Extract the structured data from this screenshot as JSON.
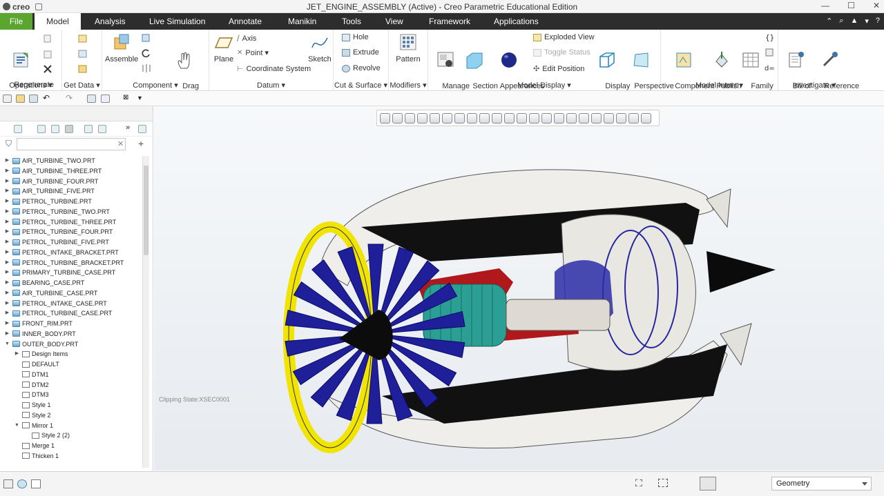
{
  "window": {
    "brand": "creo",
    "title": "JET_ENGINE_ASSEMBLY (Active) - Creo Parametric Educational Edition"
  },
  "tabs": {
    "file": "File",
    "model": "Model",
    "analysis": "Analysis",
    "live": "Live Simulation",
    "annotate": "Annotate",
    "manikin": "Manikin",
    "tools": "Tools",
    "view": "View",
    "framework": "Framework",
    "applications": "Applications"
  },
  "ribbon": {
    "operations": {
      "regenerate": "Regenerate",
      "label": "Operations ▾"
    },
    "getdata": {
      "label": "Get Data ▾"
    },
    "component": {
      "assemble": "Assemble",
      "drag": "Drag\nComponents",
      "label": "Component ▾"
    },
    "datum": {
      "plane": "Plane",
      "axis": "Axis",
      "point": "Point ▾",
      "csys": "Coordinate System",
      "sketch": "Sketch",
      "label": "Datum ▾"
    },
    "cut": {
      "hole": "Hole",
      "extrude": "Extrude",
      "revolve": "Revolve",
      "label": "Cut & Surface ▾"
    },
    "modifiers": {
      "pattern": "Pattern",
      "label": "Modifiers ▾"
    },
    "display": {
      "manage": "Manage\nViews ▾",
      "section": "Section\n▾",
      "appearances": "Appearances\n▾",
      "exploded": "Exploded View",
      "toggle": "Toggle Status",
      "editpos": "Edit Position",
      "dstyle": "Display\nStyle ▾",
      "persp": "Perspective\nView",
      "label": "Model Display ▾"
    },
    "intent": {
      "compif": "Component\nInterface",
      "publish": "Publish\nGeometry",
      "family": "Family\nTable",
      "label": "Model Intent ▾"
    },
    "investigate": {
      "bom": "Bill of\nMaterials",
      "refviewer": "Reference\nViewer",
      "label": "Investigate ▾"
    }
  },
  "tree": {
    "rows": [
      {
        "label": "AIR_TURBINE_TWO.PRT",
        "type": "part",
        "exp": true
      },
      {
        "label": "AIR_TURBINE_THREE.PRT",
        "type": "part",
        "exp": true
      },
      {
        "label": "AIR_TURBINE_FOUR.PRT",
        "type": "part",
        "exp": true
      },
      {
        "label": "AIR_TURBINE_FIVE.PRT",
        "type": "part",
        "exp": true
      },
      {
        "label": "PETROL_TURBINE.PRT",
        "type": "part",
        "exp": true
      },
      {
        "label": "PETROL_TURBINE_TWO.PRT",
        "type": "part",
        "exp": true
      },
      {
        "label": "PETROL_TURBINE_THREE.PRT",
        "type": "part",
        "exp": true
      },
      {
        "label": "PETROL_TURBINE_FOUR.PRT",
        "type": "part",
        "exp": true
      },
      {
        "label": "PETROL_TURBINE_FIVE.PRT",
        "type": "part",
        "exp": true
      },
      {
        "label": "PETROL_INTAKE_BRACKET.PRT",
        "type": "part",
        "exp": true
      },
      {
        "label": "PETROL_TURBINE_BRACKET.PRT",
        "type": "part",
        "exp": true
      },
      {
        "label": "PRIMARY_TURBINE_CASE.PRT",
        "type": "part",
        "exp": true
      },
      {
        "label": "BEARING_CASE.PRT",
        "type": "part",
        "exp": true
      },
      {
        "label": "AIR_TURBINE_CASE.PRT",
        "type": "part",
        "exp": true
      },
      {
        "label": "PETROL_INTAKE_CASE.PRT",
        "type": "part",
        "exp": true
      },
      {
        "label": "PETROL_TURBINE_CASE.PRT",
        "type": "part",
        "exp": true
      },
      {
        "label": "FRONT_RIM.PRT",
        "type": "part",
        "exp": true
      },
      {
        "label": "INNER_BODY.PRT",
        "type": "part",
        "exp": true
      },
      {
        "label": "OUTER_BODY.PRT",
        "type": "part",
        "exp": "open"
      },
      {
        "label": "Design Items",
        "type": "feat",
        "indent": 1,
        "exp": true
      },
      {
        "label": "DEFAULT",
        "type": "feat",
        "indent": 1
      },
      {
        "label": "DTM1",
        "type": "feat",
        "indent": 1
      },
      {
        "label": "DTM2",
        "type": "feat",
        "indent": 1
      },
      {
        "label": "DTM3",
        "type": "feat",
        "indent": 1
      },
      {
        "label": "Style 1",
        "type": "feat",
        "indent": 1
      },
      {
        "label": "Style 2",
        "type": "feat",
        "indent": 1
      },
      {
        "label": "Mirror 1",
        "type": "feat",
        "indent": 1,
        "exp": "open"
      },
      {
        "label": "Style 2 (2)",
        "type": "feat",
        "indent": 2
      },
      {
        "label": "Merge 1",
        "type": "feat",
        "indent": 1
      },
      {
        "label": "Thicken 1",
        "type": "feat",
        "indent": 1
      }
    ]
  },
  "viewport": {
    "clipping": "Clipping State:XSEC0001"
  },
  "status": {
    "filter": "Geometry"
  },
  "colors": {
    "file_tab": "#5aa530",
    "tabbar": "#2d2d2d"
  }
}
